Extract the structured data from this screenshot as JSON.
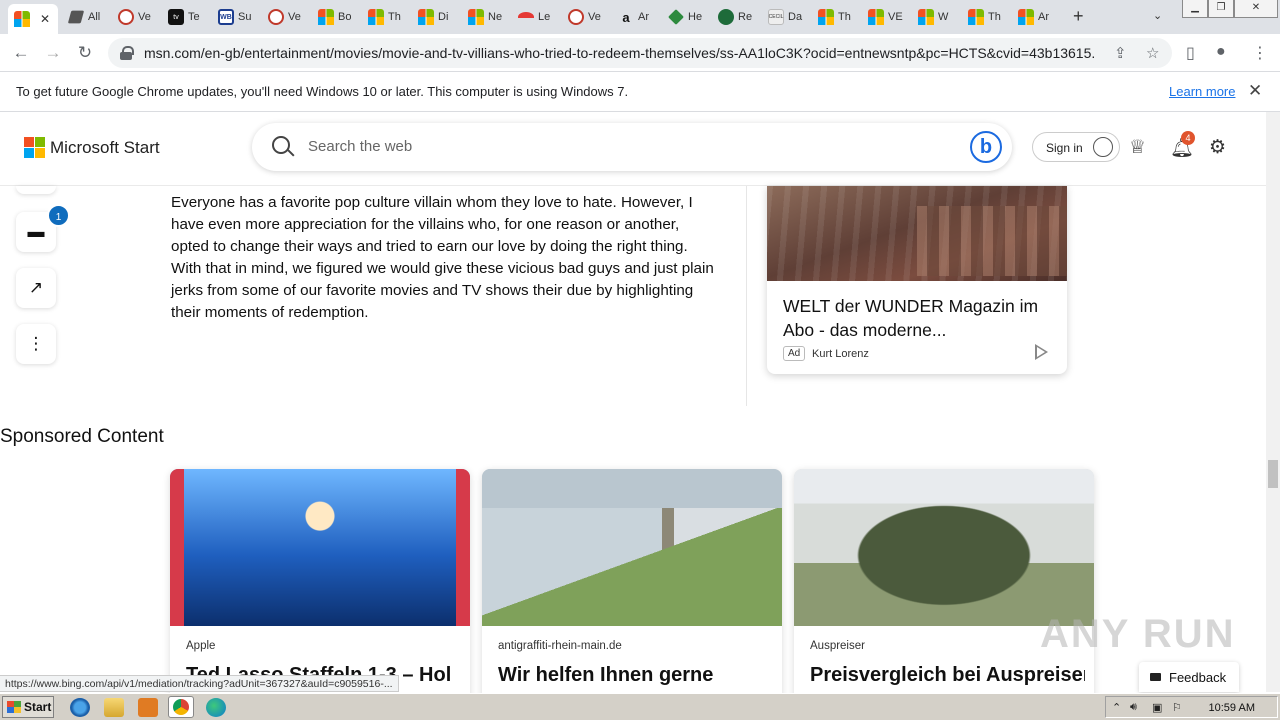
{
  "browser": {
    "tabs": [
      {
        "label": "",
        "icon": "microsoft-icon",
        "active": true
      },
      {
        "label": "All",
        "icon": "pen-icon"
      },
      {
        "label": "Ve",
        "icon": "red-circle-icon"
      },
      {
        "label": "Te",
        "icon": "appletv-icon"
      },
      {
        "label": "Su",
        "icon": "wb-icon"
      },
      {
        "label": "Ve",
        "icon": "red-circle-icon"
      },
      {
        "label": "Bo",
        "icon": "microsoft-icon"
      },
      {
        "label": "Th",
        "icon": "microsoft-icon"
      },
      {
        "label": "Di",
        "icon": "microsoft-icon"
      },
      {
        "label": "Ne",
        "icon": "microsoft-icon"
      },
      {
        "label": "Le",
        "icon": "red-arc-icon"
      },
      {
        "label": "Ve",
        "icon": "red-circle-icon"
      },
      {
        "label": "Ar",
        "icon": "amazon-icon"
      },
      {
        "label": "He",
        "icon": "tag-icon"
      },
      {
        "label": "Re",
        "icon": "green-circle-icon"
      },
      {
        "label": "Da",
        "icon": "cecil-icon"
      },
      {
        "label": "Th",
        "icon": "microsoft-icon"
      },
      {
        "label": "VE",
        "icon": "microsoft-icon"
      },
      {
        "label": "W",
        "icon": "microsoft-icon"
      },
      {
        "label": "Th",
        "icon": "microsoft-icon"
      },
      {
        "label": "Ar",
        "icon": "microsoft-icon"
      }
    ],
    "url": "msn.com/en-gb/entertainment/movies/movie-and-tv-villians-who-tried-to-redeem-themselves/ss-AA1loC3K?ocid=entnewsntp&pc=HCTS&cvid=43b13615...",
    "notice": {
      "text": "To get future Google Chrome updates, you'll need Windows 10 or later. This computer is using Windows 7.",
      "link": "Learn more"
    },
    "status_url": "https://www.bing.com/api/v1/mediation/tracking?adUnit=367327&auId=c9059516-..."
  },
  "header": {
    "brand": "Microsoft Start",
    "search_placeholder": "Search the web",
    "signin": "Sign in",
    "notification_count": "4"
  },
  "rail": {
    "comment_count": "1"
  },
  "article": {
    "text": "Everyone has a favorite pop culture villain whom they love to hate. However, I have even more appreciation for the villains who, for one reason or another, opted to change their ways and tried to earn our love by doing the right thing. With that in mind, we figured we would give these vicious bad guys and just plain jerks from some of our favorite movies and TV shows their due by highlighting their moments of redemption."
  },
  "ad": {
    "title": "WELT der WUNDER Magazin im Abo - das moderne...",
    "tag": "Ad",
    "source": "Kurt Lorenz"
  },
  "sponsored": {
    "heading": "Sponsored Content",
    "cards": [
      {
        "source": "Apple",
        "title": "Ted Lasso Staffeln 1-3 – Hol"
      },
      {
        "source": "antigraffiti-rhein-main.de",
        "title": "Wir helfen Ihnen gerne"
      },
      {
        "source": "Auspreiser",
        "title": "Preisvergleich bei Auspreiser"
      }
    ]
  },
  "feedback": "Feedback",
  "watermark": "ANY RUN",
  "taskbar": {
    "start": "Start",
    "clock": "10:59 AM"
  }
}
